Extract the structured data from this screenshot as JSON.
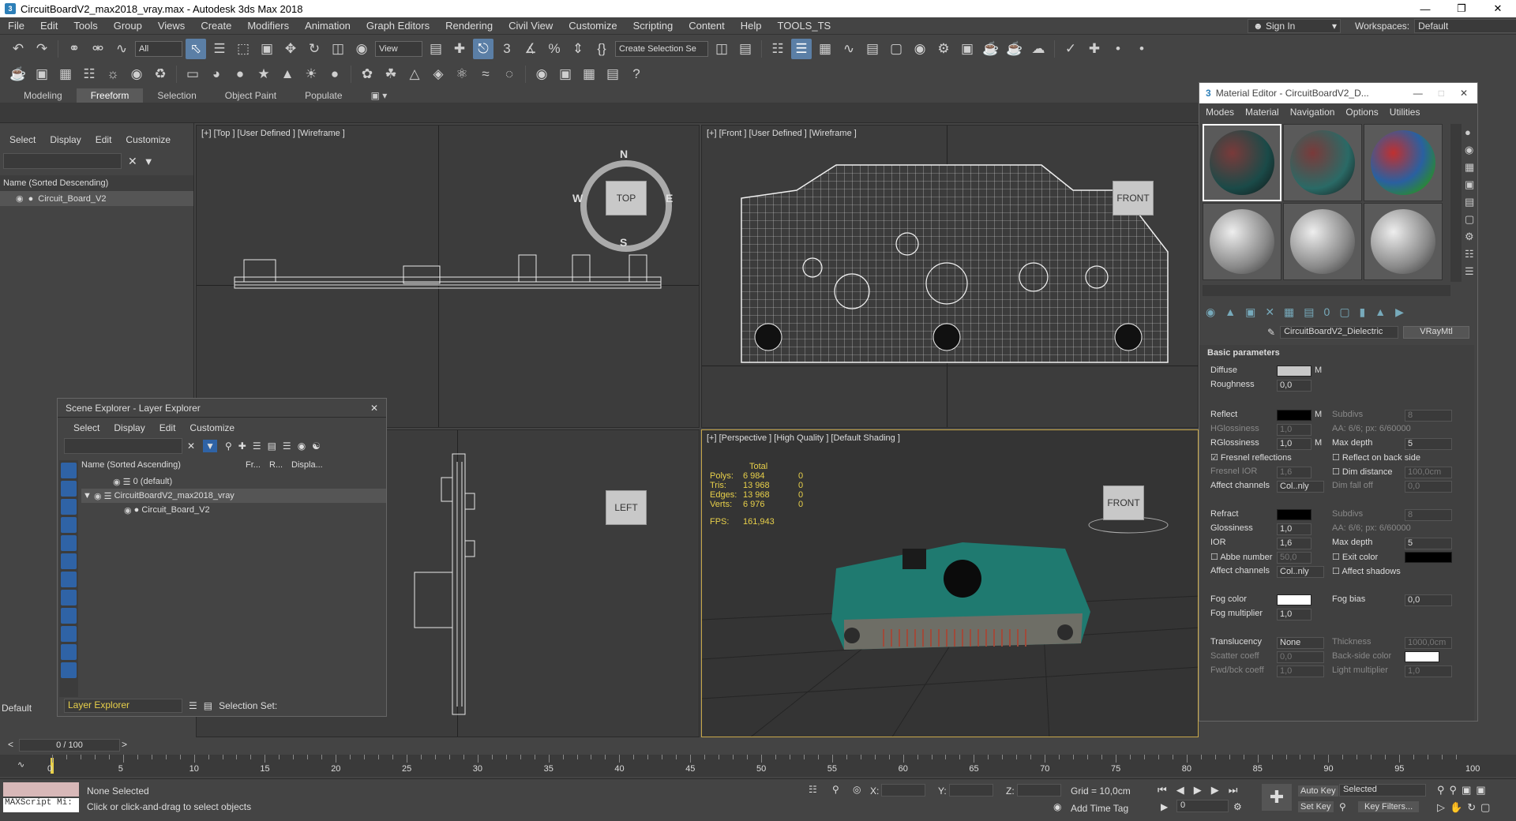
{
  "window": {
    "title": "CircuitBoardV2_max2018_vray.max - Autodesk 3ds Max 2018",
    "app_icon": "3"
  },
  "menu": {
    "items": [
      "File",
      "Edit",
      "Tools",
      "Group",
      "Views",
      "Create",
      "Modifiers",
      "Animation",
      "Graph Editors",
      "Rendering",
      "Civil View",
      "Customize",
      "Scripting",
      "Content",
      "Help",
      "TOOLS_TS"
    ],
    "sign_in": "Sign In",
    "workspaces_label": "Workspaces:",
    "workspaces_value": "Default"
  },
  "toolbar": {
    "filter_value": "All",
    "view_value": "View",
    "selection_set": "Create Selection Se"
  },
  "ribbon": {
    "tabs": [
      "Modeling",
      "Freeform",
      "Selection",
      "Object Paint",
      "Populate"
    ],
    "active": "Freeform"
  },
  "left_panel": {
    "menu": [
      "Select",
      "Display",
      "Edit",
      "Customize"
    ],
    "header": "Name (Sorted Descending)",
    "rows": [
      "Circuit_Board_V2"
    ],
    "bottom_label": "Default"
  },
  "viewports": {
    "top": {
      "label": "[+] [Top ] [User Defined ] [Wireframe ]",
      "cube": "TOP",
      "n": "N",
      "s": "S",
      "w": "W",
      "e": "E"
    },
    "front": {
      "label": "[+] [Front ] [User Defined ] [Wireframe ]",
      "cube": "FRONT"
    },
    "left": {
      "cube": "LEFT"
    },
    "perspective": {
      "label": "[+] [Perspective ] [High Quality ] [Default Shading ]",
      "cube": "FRONT",
      "stats_title": "Total",
      "stats": [
        {
          "k": "Polys:",
          "v": "6 984",
          "z": "0"
        },
        {
          "k": "Tris:",
          "v": "13 968",
          "z": "0"
        },
        {
          "k": "Edges:",
          "v": "13 968",
          "z": "0"
        },
        {
          "k": "Verts:",
          "v": "6 976",
          "z": "0"
        }
      ],
      "fps_label": "FPS:",
      "fps_value": "161,943"
    }
  },
  "scene_explorer": {
    "title": "Scene Explorer - Layer Explorer",
    "menu": [
      "Select",
      "Display",
      "Edit",
      "Customize"
    ],
    "col_name": "Name (Sorted Ascending)",
    "col_fr": "Fr...",
    "col_r": "R...",
    "col_disp": "Displa...",
    "rows": [
      "0 (default)",
      "CircuitBoardV2_max2018_vray",
      "Circuit_Board_V2"
    ],
    "footer_explorer": "Layer Explorer",
    "footer_selset": "Selection Set:"
  },
  "material_editor": {
    "title": "Material Editor - CircuitBoardV2_D...",
    "menu": [
      "Modes",
      "Material",
      "Navigation",
      "Options",
      "Utilities"
    ],
    "material_name": "CircuitBoardV2_Dielectric",
    "material_type": "VRayMtl",
    "section": "Basic parameters",
    "diffuse": "Diffuse",
    "roughness": "Roughness",
    "roughness_v": "0,0",
    "reflect": "Reflect",
    "subdivs": "Subdivs",
    "subdivs_v": "8",
    "hglossiness": "HGlossiness",
    "hgloss_v": "1,0",
    "aa": "AA: 6/6; px: 6/60000",
    "rglossiness": "RGlossiness",
    "rgloss_v": "1,0",
    "max_depth": "Max depth",
    "max_depth_v": "5",
    "fresnel": "Fresnel reflections",
    "reflect_back": "Reflect on back side",
    "fresnel_ior": "Fresnel IOR",
    "fresnel_ior_v": "1,6",
    "dim_distance": "Dim distance",
    "dim_distance_v": "100,0cm",
    "affect_channels": "Affect channels",
    "affect_v": "Col..nly",
    "dim_falloff": "Dim fall off",
    "dim_falloff_v": "0,0",
    "refract": "Refract",
    "glossiness": "Glossiness",
    "gloss_v": "1,0",
    "ior": "IOR",
    "ior_v": "1,6",
    "abbe": "Abbe number",
    "abbe_v": "50,0",
    "exit_color": "Exit color",
    "affect_shadows": "Affect shadows",
    "fog_color": "Fog color",
    "fog_bias": "Fog bias",
    "fog_bias_v": "0,0",
    "fog_mult": "Fog multiplier",
    "fog_mult_v": "1,0",
    "translucency": "Translucency",
    "translucency_v": "None",
    "thickness": "Thickness",
    "thickness_v": "1000,0cm",
    "scatter": "Scatter coeff",
    "scatter_v": "0,0",
    "backside": "Back-side color",
    "fwd": "Fwd/bck coeff",
    "fwd_v": "1,0",
    "light_mult": "Light multiplier",
    "light_mult_v": "1,0",
    "m": "M"
  },
  "timeline": {
    "frame": "0 / 100",
    "ticks": [
      "0",
      "5",
      "10",
      "15",
      "20",
      "25",
      "30",
      "35",
      "40",
      "45",
      "50",
      "55",
      "60",
      "65",
      "70",
      "75",
      "80",
      "85",
      "90",
      "95",
      "100"
    ]
  },
  "status": {
    "maxscript": "MAXScript Mi:",
    "selected": "None Selected",
    "prompt": "Click or click-and-drag to select objects",
    "x": "X:",
    "y": "Y:",
    "z": "Z:",
    "grid": "Grid = 10,0cm",
    "add_time_tag": "Add Time Tag",
    "auto_key": "Auto Key",
    "set_key": "Set Key",
    "selected_dd": "Selected",
    "key_filters": "Key Filters...",
    "frame_field": "0"
  }
}
